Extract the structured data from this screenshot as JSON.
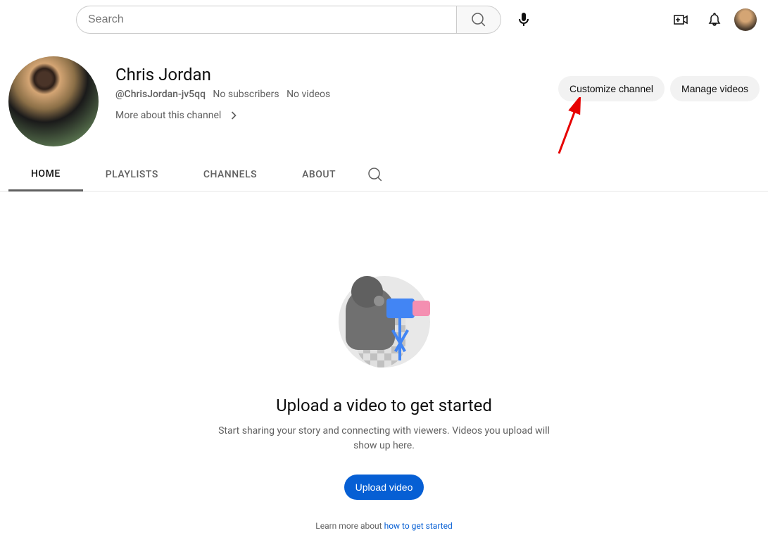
{
  "search": {
    "placeholder": "Search"
  },
  "channel": {
    "name": "Chris Jordan",
    "handle": "@ChrisJordan-jv5qq",
    "subscribers": "No subscribers",
    "videos": "No videos",
    "more_label": "More about this channel"
  },
  "actions": {
    "customize": "Customize channel",
    "manage": "Manage videos"
  },
  "tabs": {
    "home": "HOME",
    "playlists": "PLAYLISTS",
    "channels": "CHANNELS",
    "about": "ABOUT"
  },
  "empty": {
    "title": "Upload a video to get started",
    "desc": "Start sharing your story and connecting with viewers. Videos you upload will show up here.",
    "button": "Upload video",
    "learn_prefix": "Learn more about ",
    "learn_link": "how to get started"
  }
}
